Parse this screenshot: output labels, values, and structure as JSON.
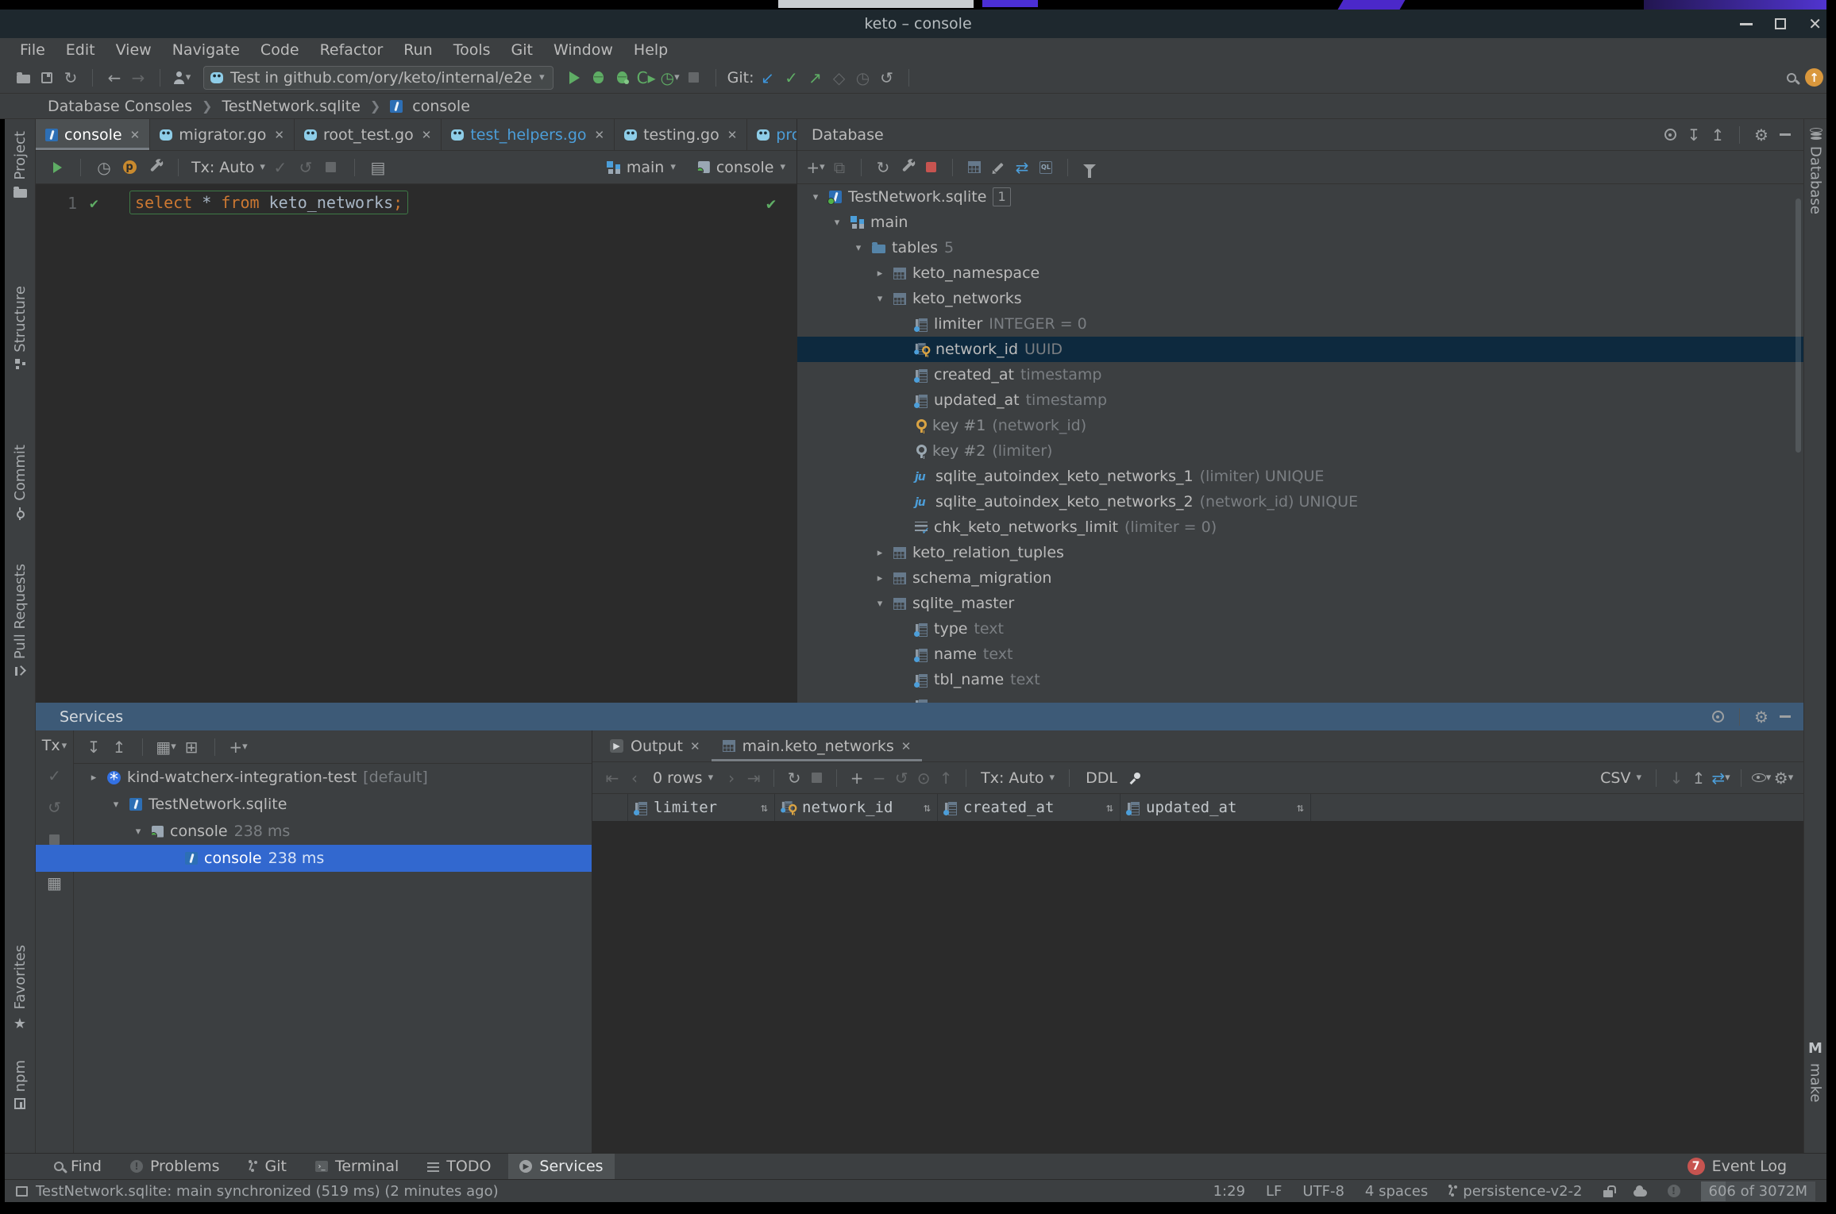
{
  "window": {
    "title": "keto – console"
  },
  "colors": {
    "selection_blue": "#3268cf",
    "inactive_selection": "#0d293e",
    "keyword_orange": "#cc7832",
    "run_green": "#5fad65",
    "modified_blue": "#4c9ed9",
    "panel_bg": "#3c3f41",
    "editor_bg": "#2b2b2b"
  },
  "menu": {
    "items": [
      "File",
      "Edit",
      "View",
      "Navigate",
      "Code",
      "Refactor",
      "Run",
      "Tools",
      "Git",
      "Window",
      "Help"
    ]
  },
  "toolbar": {
    "run_config": "Test in github.com/ory/keto/internal/e2e",
    "git_label": "Git:"
  },
  "breadcrumbs": {
    "items": [
      "Database Consoles",
      "TestNetwork.sqlite",
      "console"
    ]
  },
  "left_strip": {
    "project": "Project",
    "structure": "Structure",
    "commit": "Commit",
    "pull_requests": "Pull Requests",
    "favorites": "Favorites",
    "npm": "npm"
  },
  "right_strip": {
    "database": "Database",
    "make": "make",
    "make_icon": "M"
  },
  "editor": {
    "tabs": [
      {
        "label": "console"
      },
      {
        "label": "migrator.go"
      },
      {
        "label": "root_test.go"
      },
      {
        "label": "test_helpers.go"
      },
      {
        "label": "testing.go"
      },
      {
        "label": "prov"
      }
    ],
    "toolbar": {
      "tx": "Tx: Auto",
      "schema": "main",
      "session": "console"
    },
    "line_number": "1",
    "code": {
      "kw1": "select",
      "star": "*",
      "kw2": "from",
      "ident": "keto_networks",
      "semi": ";"
    }
  },
  "db": {
    "title": "Database",
    "tree": [
      {
        "label": "TestNetwork.sqlite",
        "badge": "1"
      },
      {
        "label": "main"
      },
      {
        "label": "tables",
        "suffix": "5"
      },
      {
        "label": "keto_namespace"
      },
      {
        "label": "keto_networks"
      },
      {
        "label": "limiter",
        "suffix": "INTEGER = 0"
      },
      {
        "label": "network_id",
        "suffix": "UUID"
      },
      {
        "label": "created_at",
        "suffix": "timestamp"
      },
      {
        "label": "updated_at",
        "suffix": "timestamp"
      },
      {
        "label": "key #1",
        "suffix": "(network_id)"
      },
      {
        "label": "key #2",
        "suffix": "(limiter)"
      },
      {
        "label": "sqlite_autoindex_keto_networks_1",
        "suffix": "(limiter) UNIQUE"
      },
      {
        "label": "sqlite_autoindex_keto_networks_2",
        "suffix": "(network_id) UNIQUE"
      },
      {
        "label": "chk_keto_networks_limit",
        "suffix": "(limiter = 0)"
      },
      {
        "label": "keto_relation_tuples"
      },
      {
        "label": "schema_migration"
      },
      {
        "label": "sqlite_master"
      },
      {
        "label": "type",
        "suffix": "text"
      },
      {
        "label": "name",
        "suffix": "text"
      },
      {
        "label": "tbl_name",
        "suffix": "text"
      }
    ]
  },
  "services": {
    "title": "Services",
    "tx_label": "Tx",
    "tree": [
      {
        "label": "kind-watcherx-integration-test",
        "suffix": "[default]"
      },
      {
        "label": "TestNetwork.sqlite"
      },
      {
        "label": "console",
        "suffix": "238 ms"
      },
      {
        "label": "console",
        "suffix": "238 ms"
      }
    ],
    "output_tabs": [
      {
        "label": "Output"
      },
      {
        "label": "main.keto_networks"
      }
    ],
    "grid": {
      "rows_label": "0 rows",
      "tx": "Tx: Auto",
      "ddl": "DDL",
      "format": "CSV",
      "columns": [
        {
          "name": "limiter"
        },
        {
          "name": "network_id"
        },
        {
          "name": "created_at"
        },
        {
          "name": "updated_at"
        }
      ]
    }
  },
  "bottom_bar": {
    "items": [
      "Find",
      "Problems",
      "Git",
      "Terminal",
      "TODO",
      "Services"
    ],
    "event_log": {
      "label": "Event Log",
      "badge": "7"
    }
  },
  "status_bar": {
    "message": "TestNetwork.sqlite: main synchronized (519 ms) (2 minutes ago)",
    "position": "1:29",
    "line_ending": "LF",
    "encoding": "UTF-8",
    "indent": "4 spaces",
    "branch": "persistence-v2-2",
    "memory": "606 of 3072M"
  }
}
